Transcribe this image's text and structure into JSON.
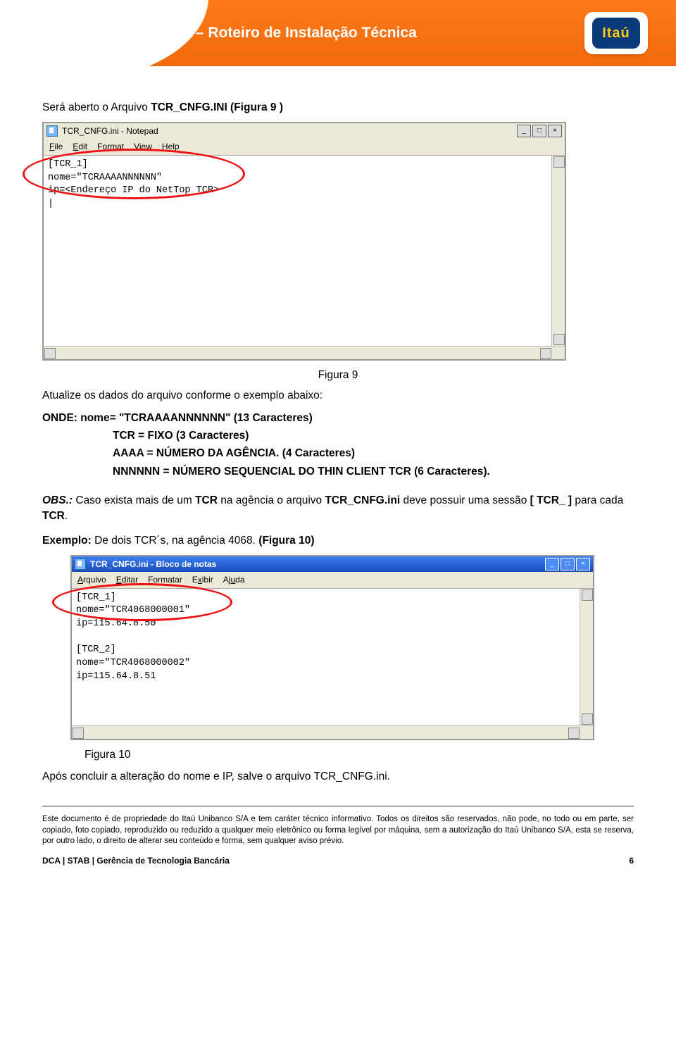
{
  "header": {
    "title": "RIT – Roteiro de Instalação Técnica",
    "logo_text": "Itaú"
  },
  "intro": {
    "prefix": "Será aberto o Arquivo ",
    "filename": "TCR_CNFG.INI",
    "suffix": " (Figura 9 )"
  },
  "notepad1": {
    "title": "TCR_CNFG.ini - Notepad",
    "menu": [
      "File",
      "Edit",
      "Format",
      "View",
      "Help"
    ],
    "lines": "[TCR_1]\nnome=\"TCRAAAANNNNNN\"\nip=<Endereço IP do NetTop TCR>\n|"
  },
  "fig9_label": "Figura 9",
  "update_line": "Atualize os dados do arquivo conforme o exemplo abaixo:",
  "onde": {
    "l1a": "ONDE:  nome= \"TCRAAAANNNNNN\" (13 Caracteres)",
    "l2": "TCR = FIXO (3 Caracteres)",
    "l3": "AAAA = NÚMERO DA AGÊNCIA. (4 Caracteres)",
    "l4": "NNNNNN = NÚMERO SEQUENCIAL DO THIN CLIENT  TCR (6 Caracteres)."
  },
  "obs": {
    "label": "OBS.:",
    "t1": " Caso exista mais de um ",
    "tcr": "TCR",
    "t2": " na agência o arquivo ",
    "file": "TCR_CNFG.ini",
    "t3": " deve possuir uma sessão ",
    "sess": "[ TCR_ ]",
    "t4": " para cada ",
    "t5": "."
  },
  "example": {
    "prefix": "Exemplo:",
    "text": " De dois TCR´s, na  agência 4068. ",
    "figref": "(Figura 10)"
  },
  "notepad2": {
    "title": "TCR_CNFG.ini - Bloco de notas",
    "menu": [
      "Arquivo",
      "Editar",
      "Formatar",
      "Exibir",
      "Ajuda"
    ],
    "lines": "[TCR_1]\nnome=\"TCR4068000001\"\nip=115.64.8.50\n\n[TCR_2]\nnome=\"TCR4068000002\"\nip=115.64.8.51"
  },
  "fig10_label": "Figura 10",
  "after_save": "Após concluir a alteração do nome e IP, salve o arquivo TCR_CNFG.ini.",
  "disclaimer": "Este documento é de propriedade do Itaú Unibanco S/A e tem caráter técnico informativo. Todos os direitos são reservados, não pode, no todo ou em parte, ser copiado, foto copiado, reproduzido ou reduzido a qualquer meio eletrônico ou forma legível por máquina, sem a autorização do Itaú Unibanco S/A, esta se reserva, por outro lado, o direito de alterar seu conteúdo e forma, sem qualquer aviso prévio.",
  "footer": {
    "left": "DCA | STAB | Gerência de Tecnologia Bancária",
    "page": "6"
  }
}
